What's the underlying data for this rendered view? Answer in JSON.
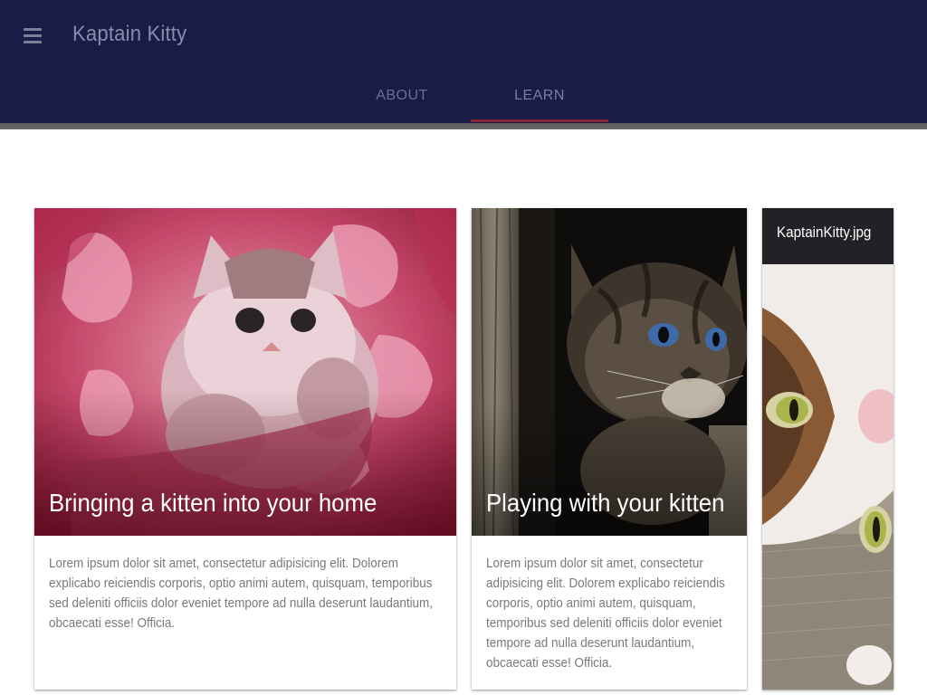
{
  "app": {
    "title": "Kaptain Kitty"
  },
  "tabs": [
    {
      "label": "ABOUT",
      "active": false
    },
    {
      "label": "LEARN",
      "active": true
    }
  ],
  "colors": {
    "appbar": "#181c46",
    "tab_indicator": "#8c2238"
  },
  "cards": [
    {
      "title": "Bringing a kitten into your home",
      "text": "Lorem ipsum dolor sit amet, consectetur adipisicing elit. Dolorem explicabo reiciendis corporis, optio animi autem, quisquam, temporibus sed deleniti officiis dolor eveniet tempore ad nulla deserunt laudantium, obcaecati esse! Officia.",
      "image": "pink-kitten-photo"
    },
    {
      "title": "Playing with your kitten",
      "text": "Lorem ipsum dolor sit amet, consectetur adipisicing elit. Dolorem explicabo reiciendis corporis, optio animi autem, quisquam, temporibus sed deleniti officiis dolor eveniet tempore ad nulla deserunt laudantium, obcaecati esse! Officia.",
      "image": "tabby-kitten-photo"
    },
    {
      "caption": "KaptainKitty.jpg",
      "image": "upside-down-cat-photo"
    }
  ]
}
